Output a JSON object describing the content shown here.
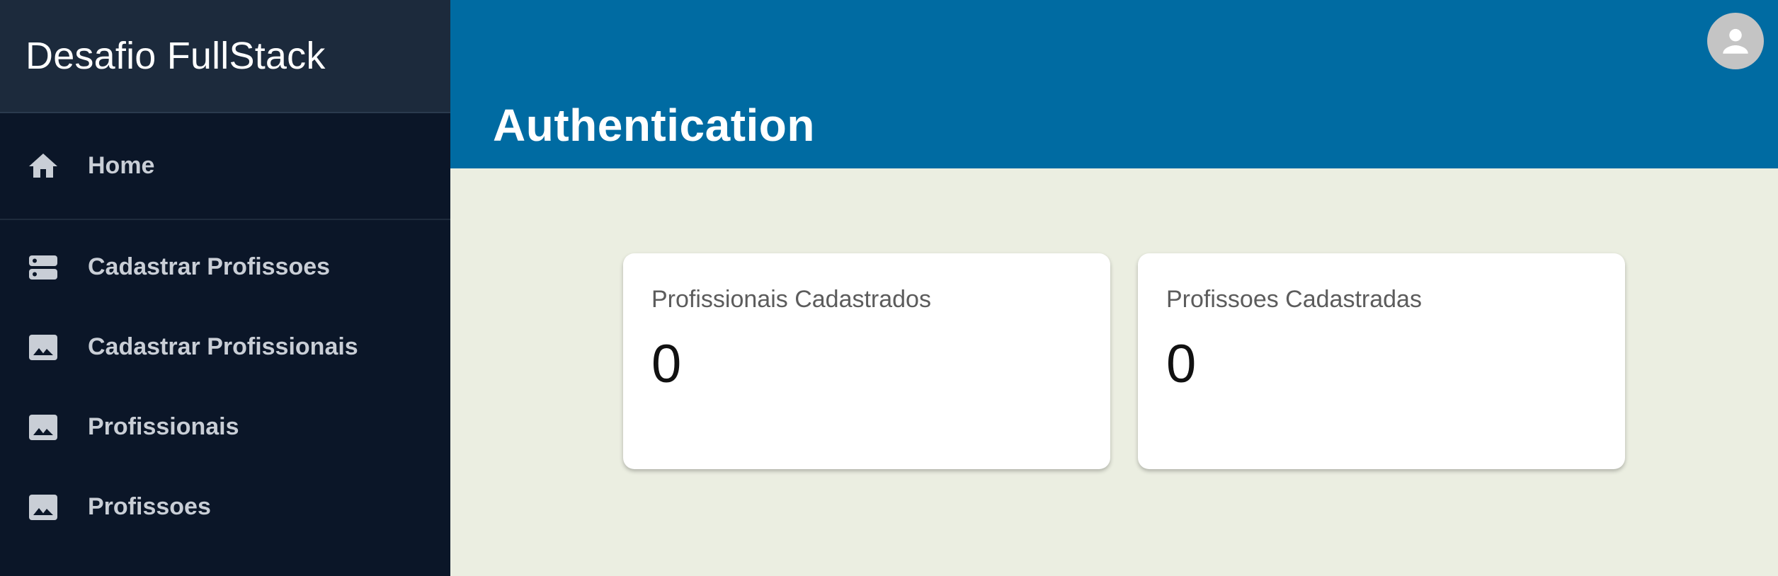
{
  "app": {
    "title": "Desafio FullStack"
  },
  "sidebar": {
    "items": [
      {
        "label": "Home",
        "icon": "home-icon"
      },
      {
        "label": "Cadastrar Profissoes",
        "icon": "storage-icon"
      },
      {
        "label": "Cadastrar Profissionais",
        "icon": "image-icon"
      },
      {
        "label": "Profissionais",
        "icon": "image-icon"
      },
      {
        "label": "Profissoes",
        "icon": "image-icon"
      }
    ]
  },
  "header": {
    "title": "Authentication",
    "avatar_icon": "account-icon"
  },
  "cards": [
    {
      "title": "Profissionais Cadastrados",
      "value": "0"
    },
    {
      "title": "Profissoes Cadastradas",
      "value": "0"
    }
  ],
  "colors": {
    "sidebar_bg": "#0b1628",
    "brand_bg": "#1c2a3c",
    "header_bg": "#006ba2",
    "content_bg": "#ebeee1",
    "card_bg": "#ffffff"
  }
}
